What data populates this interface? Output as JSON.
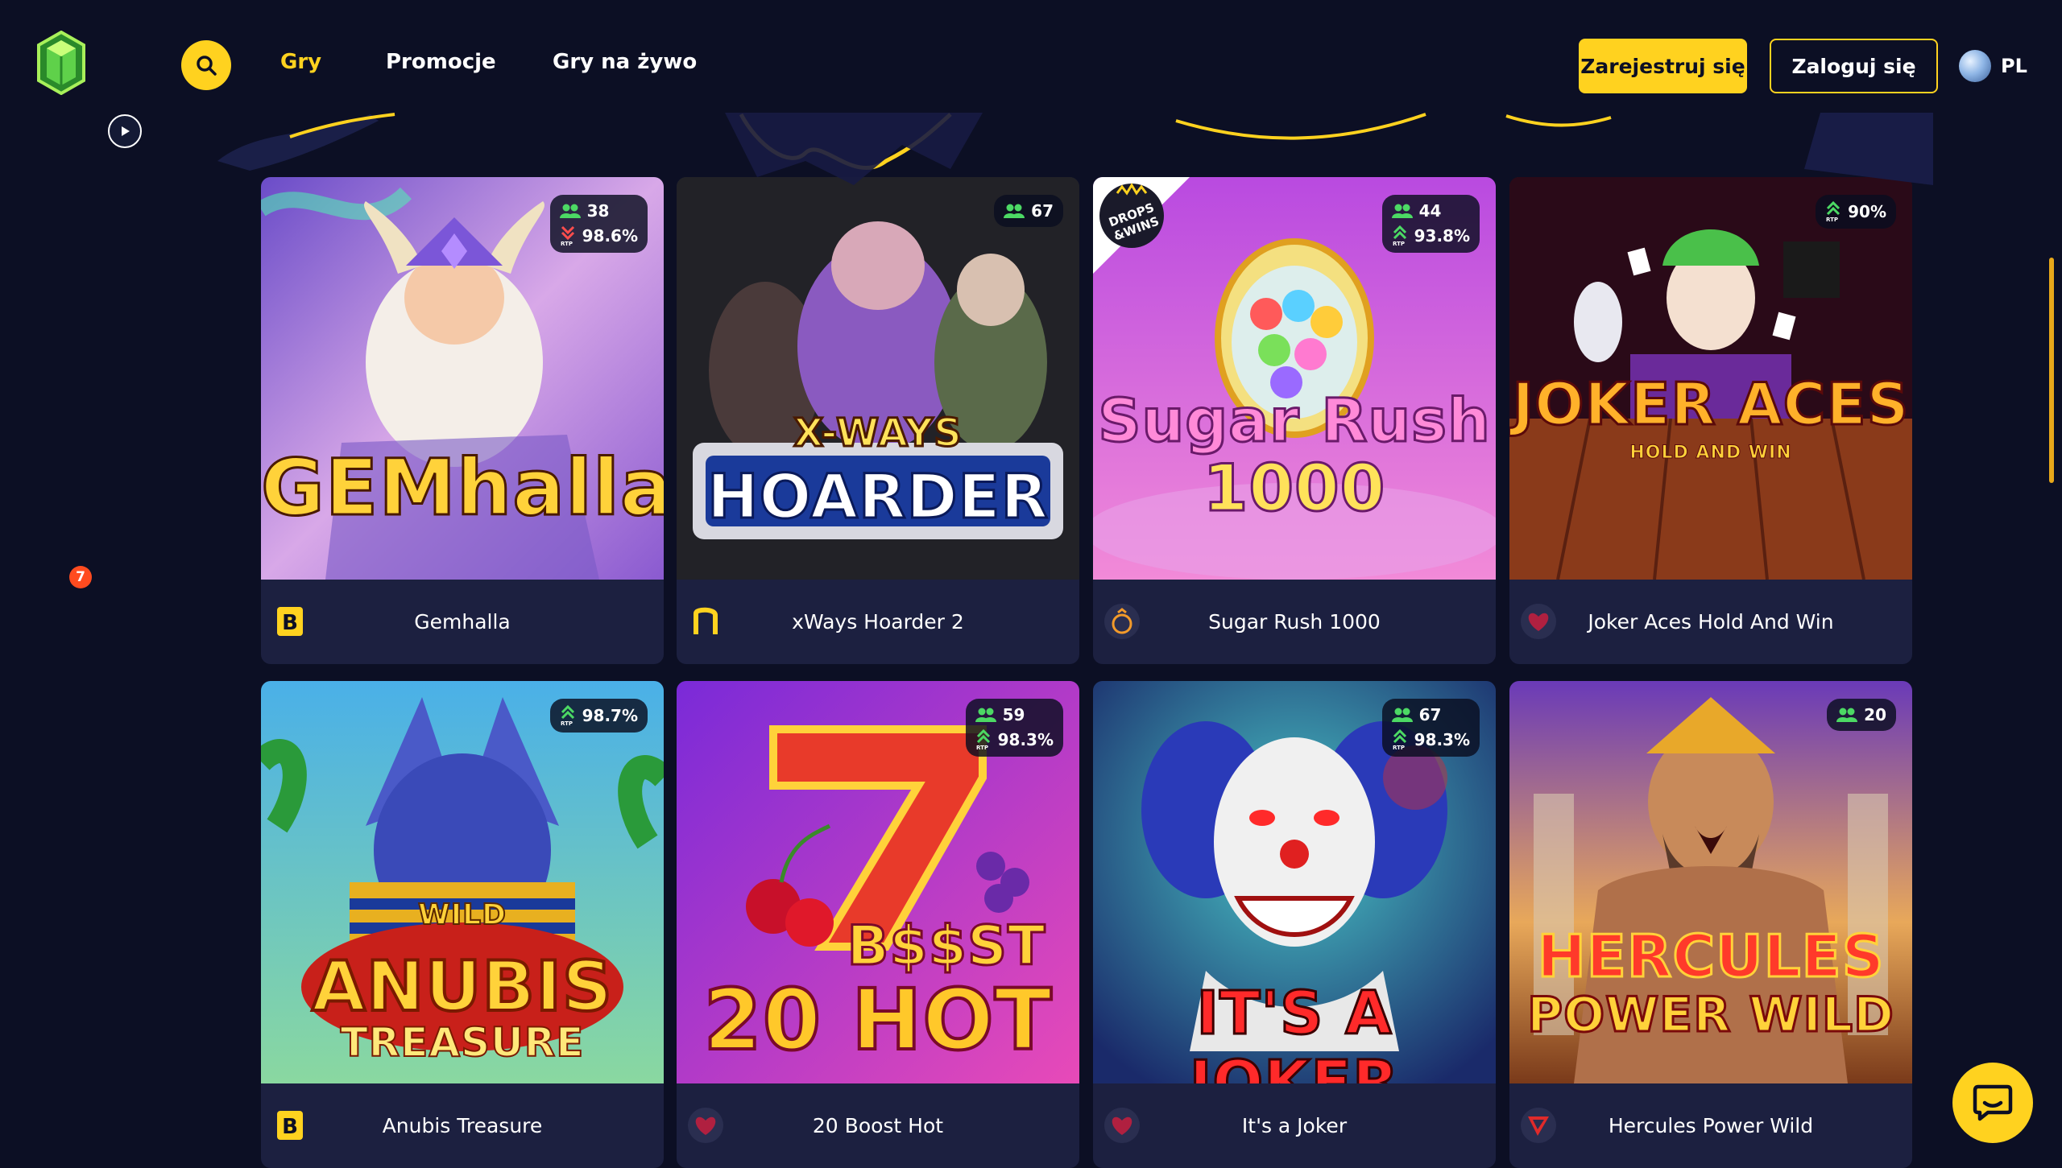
{
  "header": {
    "nav": [
      {
        "label": "Gry",
        "active": true
      },
      {
        "label": "Promocje",
        "active": false
      },
      {
        "label": "Gry na żywo",
        "active": false
      }
    ],
    "register_label": "Zarejestruj się",
    "login_label": "Zaloguj się",
    "language": "PL"
  },
  "sidebar": {
    "items": [
      {
        "icon": "wheel-of-fortune-icon"
      },
      {
        "icon": "treasure-chest-icon"
      },
      {
        "icon": "dice-icon"
      },
      {
        "icon": "cards-icon"
      },
      {
        "icon": "bomb-icon",
        "badge": "7"
      },
      {
        "icon": "trophy-icon"
      },
      {
        "icon": "crown-icon"
      },
      {
        "icon": "microphone-icon"
      },
      {
        "icon": "mobile-icon"
      }
    ]
  },
  "games": [
    {
      "name": "Gemhalla",
      "art_title": "GEMhalla",
      "players": "38",
      "rtp": "98.6%",
      "rtp_trend": "down",
      "provider": "B"
    },
    {
      "name": "xWays Hoarder 2",
      "art_title": "HOARDER",
      "art_subtitle": "X-WAYS",
      "players": "67",
      "provider": "n"
    },
    {
      "name": "Sugar Rush 1000",
      "art_title": "Sugar Rush",
      "art_subtitle": "1000",
      "players": "44",
      "rtp": "93.8%",
      "rtp_trend": "up",
      "provider": "pragmatic",
      "drops_badge": "DROPS & WINS"
    },
    {
      "name": "Joker Aces Hold And Win",
      "art_title": "JOKER ACES",
      "art_subtitle": "HOLD AND WIN",
      "rtp": "90%",
      "rtp_trend": "up",
      "provider": "heart"
    },
    {
      "name": "Anubis Treasure",
      "art_title": "ANUBIS",
      "art_subtitle": "TREASURE",
      "art_tag": "WILD",
      "rtp": "98.7%",
      "rtp_trend": "up",
      "provider": "B"
    },
    {
      "name": "20 Boost Hot",
      "art_title": "20 HOT",
      "art_subtitle": "B$$ST",
      "players": "59",
      "rtp": "98.3%",
      "rtp_trend": "up",
      "provider": "heart"
    },
    {
      "name": "It's a Joker",
      "art_title": "IT'S A JOKER",
      "players": "67",
      "rtp": "98.3%",
      "rtp_trend": "up",
      "provider": "heart"
    },
    {
      "name": "Hercules Power Wild",
      "art_title": "HERCULES",
      "art_subtitle": "POWER WILD",
      "players": "20",
      "provider": "red"
    }
  ],
  "rtp_label": "RTP",
  "colors": {
    "accent": "#ffd21f",
    "background": "#0c0f24",
    "card": "#1c2040",
    "players_icon": "#4cd964",
    "rtp_up": "#4cd964",
    "rtp_down": "#ff4d4d"
  }
}
